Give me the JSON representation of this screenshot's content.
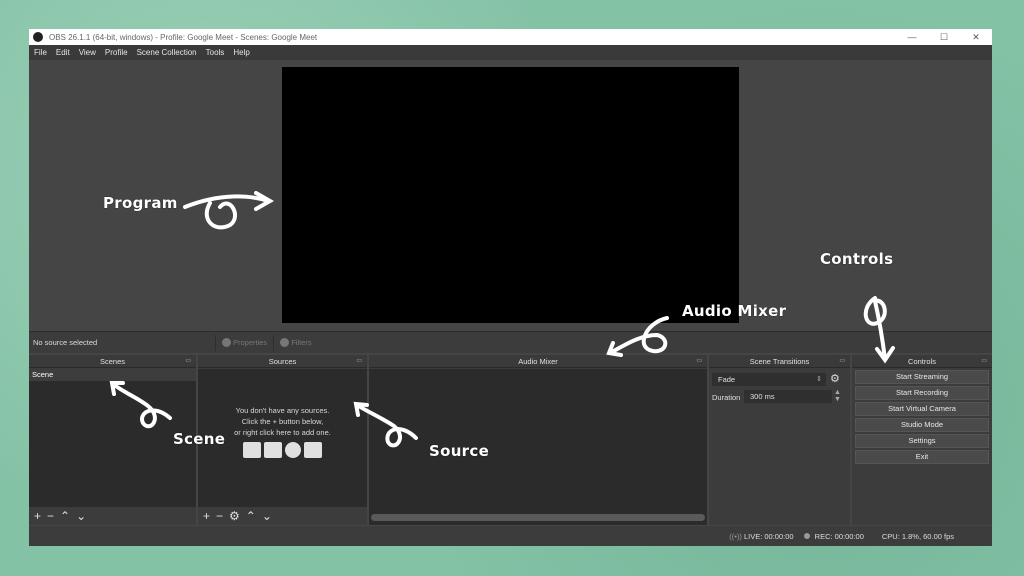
{
  "window": {
    "title": "OBS 26.1.1 (64-bit, windows) - Profile: Google Meet - Scenes: Google Meet",
    "controls": [
      "—",
      "☐",
      "✕"
    ]
  },
  "menu": [
    "File",
    "Edit",
    "View",
    "Profile",
    "Scene Collection",
    "Tools",
    "Help"
  ],
  "source_bar": {
    "status": "No source selected",
    "properties": "Properties",
    "filters": "Filters"
  },
  "docks": {
    "scenes": {
      "title": "Scenes",
      "items": [
        "Scene"
      ]
    },
    "sources": {
      "title": "Sources",
      "empty_line1": "You don't have any sources.",
      "empty_line2": "Click the + button below,",
      "empty_line3": "or right click here to add one."
    },
    "mixer": {
      "title": "Audio Mixer"
    },
    "transitions": {
      "title": "Scene Transitions",
      "selected": "Fade",
      "duration_label": "Duration",
      "duration_value": "300 ms"
    },
    "controls": {
      "title": "Controls",
      "buttons": [
        "Start Streaming",
        "Start Recording",
        "Start Virtual Camera",
        "Studio Mode",
        "Settings",
        "Exit"
      ]
    }
  },
  "status": {
    "live": "LIVE: 00:00:00",
    "rec": "REC: 00:00:00",
    "cpu": "CPU: 1.8%, 60.00 fps"
  },
  "annotations": {
    "program": "Program",
    "controls": "Controls",
    "audio_mixer": "Audio Mixer",
    "scene": "Scene",
    "source": "Source"
  },
  "colors": {
    "background": "#84c2a6",
    "obs_panel": "#3c3c3c",
    "obs_list": "#2b2b2b",
    "program": "#000000",
    "annotation": "#ffffff"
  }
}
